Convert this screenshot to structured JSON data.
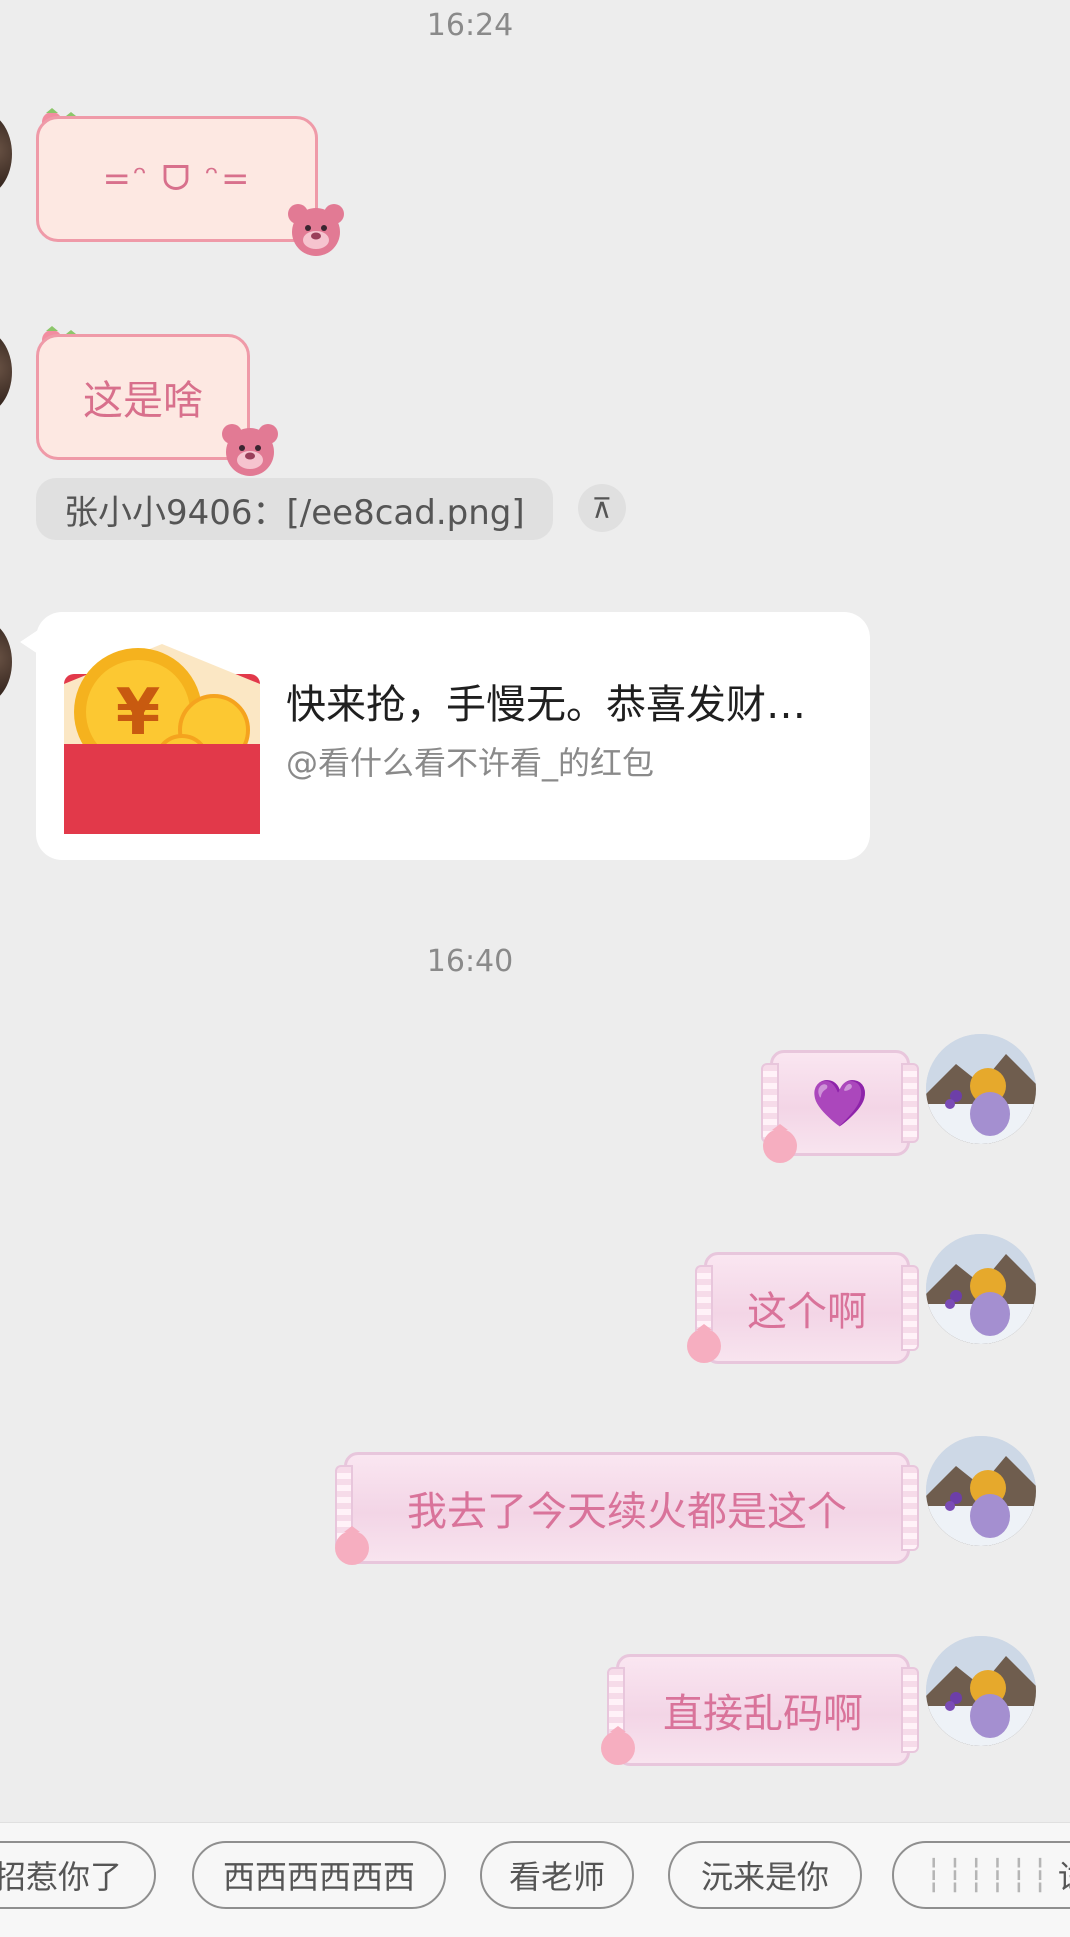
{
  "timestamps": [
    "16:24",
    "16:40"
  ],
  "left_messages": {
    "emoticon": "=ᵔ ᗜ ᵔ=",
    "text_bubble": "这是啥",
    "quote": "张小小9406：[/ee8cad.png]",
    "quote_icon": "⊼",
    "red_packet": {
      "title": "快来抢，手慢无。恭喜发财…",
      "subtitle": "@看什么看不许看_的红包",
      "icon": "red-envelope-icon"
    }
  },
  "right_messages": [
    {
      "text": "💜"
    },
    {
      "text": "这个啊"
    },
    {
      "text": "我去了今天续火都是这个"
    },
    {
      "text": "直接乱码啊"
    }
  ],
  "quick_replies": [
    "招惹你了",
    "西西西西西西",
    "看老师",
    "沅来是你",
    "┆┆┆┆┆┆",
    "试"
  ],
  "colors": {
    "background": "#ededed",
    "pink_bubble_border": "#ef9aa8",
    "pink_text": "#d8708c",
    "red_packet": "#e2394a"
  }
}
